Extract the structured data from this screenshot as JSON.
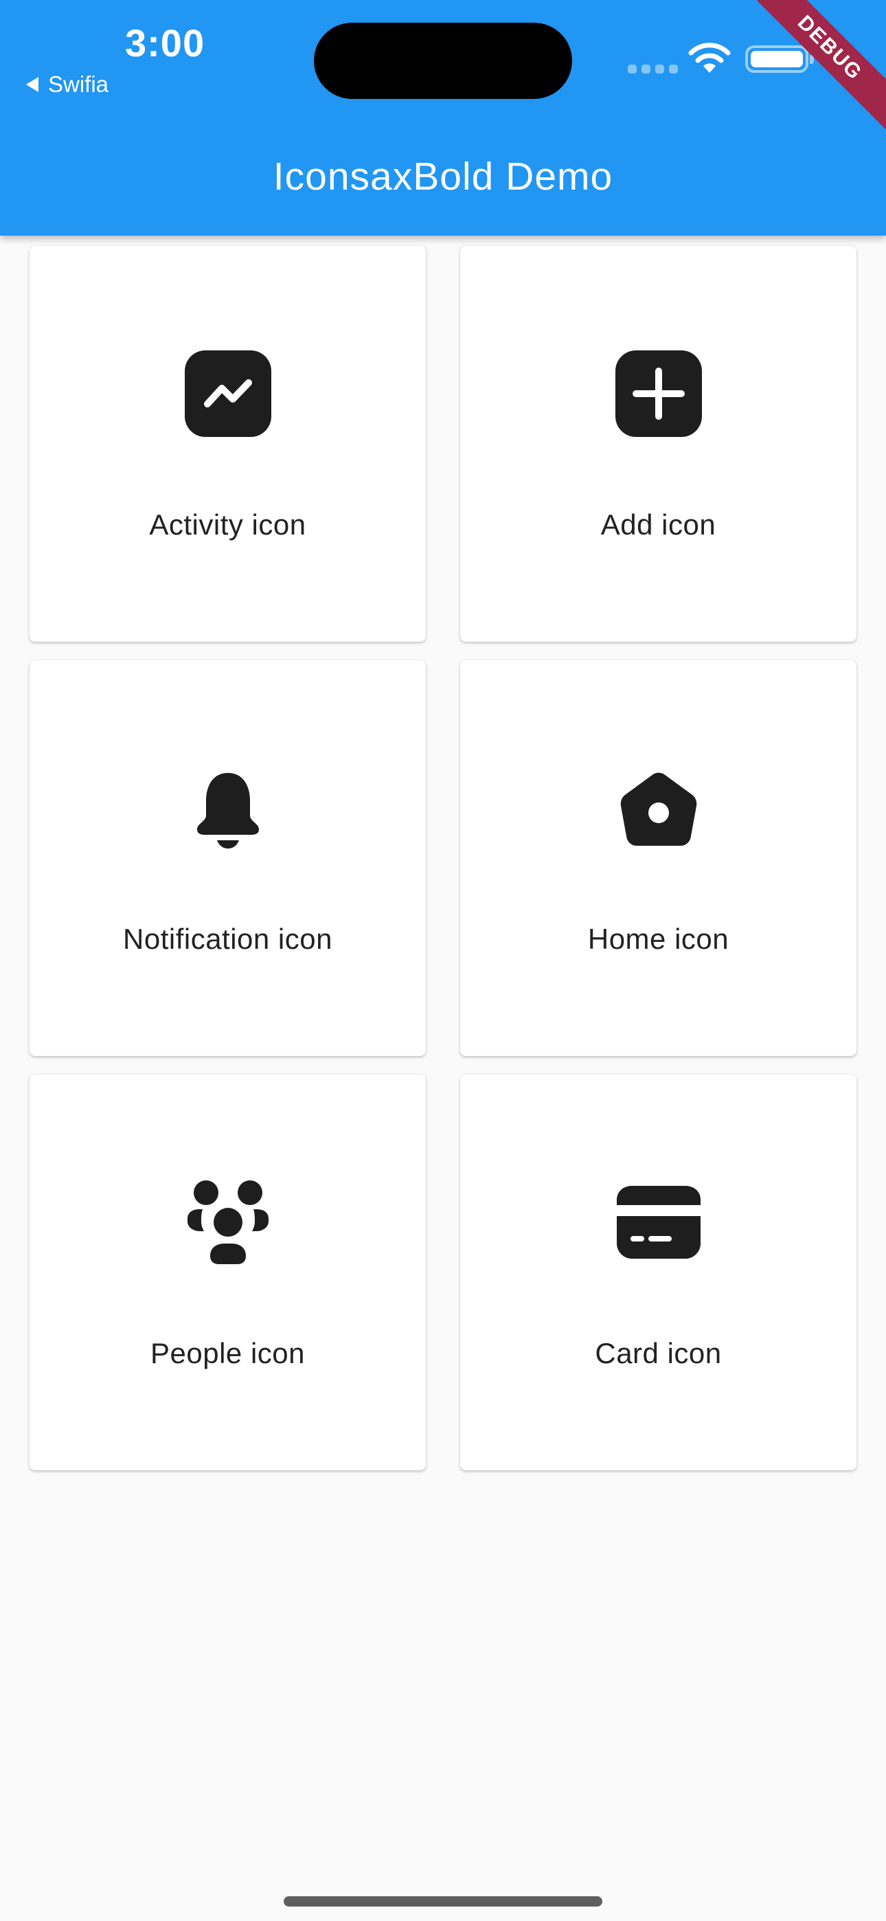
{
  "status_bar": {
    "time": "3:00",
    "back_app": "Swifia"
  },
  "app_bar": {
    "title": "IconsaxBold Demo",
    "color": "#2196f3"
  },
  "debug_banner": {
    "label": "DEBUG",
    "color": "#a0264a"
  },
  "cards": [
    {
      "label": "Activity icon",
      "icon": "activity-icon"
    },
    {
      "label": "Add icon",
      "icon": "add-icon"
    },
    {
      "label": "Notification icon",
      "icon": "notification-icon"
    },
    {
      "label": "Home icon",
      "icon": "home-icon"
    },
    {
      "label": "People icon",
      "icon": "people-icon"
    },
    {
      "label": "Card icon",
      "icon": "card-icon"
    }
  ]
}
